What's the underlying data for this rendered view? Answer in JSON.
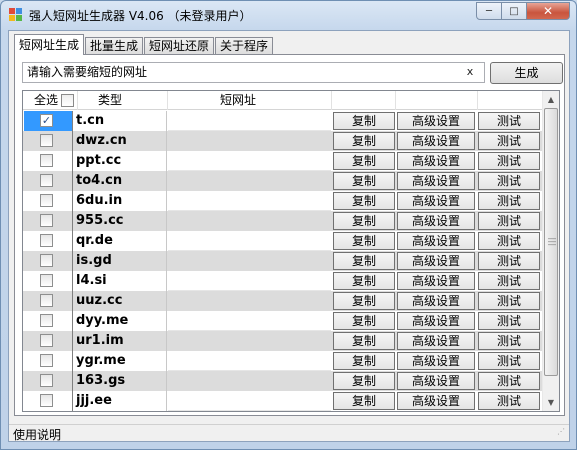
{
  "window": {
    "title": "强人短网址生成器 V4.06 （未登录用户）",
    "controls": {
      "minimize": "─",
      "maximize": "□",
      "close": "✕"
    }
  },
  "tabs": [
    {
      "label": "短网址生成",
      "active": true
    },
    {
      "label": "批量生成",
      "active": false
    },
    {
      "label": "短网址还原",
      "active": false
    },
    {
      "label": "关于程序",
      "active": false
    }
  ],
  "input": {
    "placeholder": "请输入需要缩短的网址",
    "clear_label": "x"
  },
  "generate_label": "生成",
  "grid": {
    "headers": {
      "select_all": "全选",
      "type": "类型",
      "short_url": "短网址"
    },
    "button_labels": {
      "copy": "复制",
      "advanced": "高级设置",
      "test": "测试"
    },
    "rows": [
      {
        "type": "t.cn",
        "checked": true,
        "selected": true
      },
      {
        "type": "dwz.cn",
        "checked": false
      },
      {
        "type": "ppt.cc",
        "checked": false
      },
      {
        "type": "to4.cn",
        "checked": false
      },
      {
        "type": "6du.in",
        "checked": false
      },
      {
        "type": "955.cc",
        "checked": false
      },
      {
        "type": "qr.de",
        "checked": false
      },
      {
        "type": "is.gd",
        "checked": false
      },
      {
        "type": "l4.si",
        "checked": false
      },
      {
        "type": "uuz.cc",
        "checked": false
      },
      {
        "type": "dyy.me",
        "checked": false
      },
      {
        "type": "ur1.im",
        "checked": false
      },
      {
        "type": "ygr.me",
        "checked": false
      },
      {
        "type": "163.gs",
        "checked": false
      },
      {
        "type": "jjj.ee",
        "checked": false
      }
    ]
  },
  "status": {
    "text": "使用说明"
  },
  "colors": {
    "selection": "#3399ff",
    "alt_row": "#dcdcdc",
    "title_bg": "#c9d9ec"
  }
}
